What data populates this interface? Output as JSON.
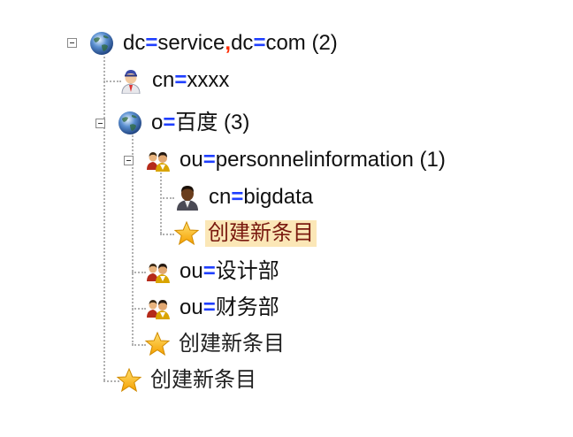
{
  "tree": {
    "root": {
      "attr1": "dc",
      "val1": "service",
      "sep": ",",
      "attr2": "dc",
      "val2": "com",
      "count": "(2)",
      "icon": "globe-icon",
      "children": {
        "user": {
          "attr": "cn",
          "value": "xxxx",
          "icon": "user-icon"
        },
        "org": {
          "attr": "o",
          "value": "百度",
          "count": "(3)",
          "icon": "globe-icon",
          "children": {
            "ou1": {
              "attr": "ou",
              "value": "personnelinformation",
              "count": "(1)",
              "icon": "group-icon",
              "children": {
                "person": {
                  "attr": "cn",
                  "value": "bigdata",
                  "icon": "person-icon"
                },
                "create": {
                  "label": "创建新条目",
                  "icon": "star-icon",
                  "selected": true
                }
              }
            },
            "ou2": {
              "attr": "ou",
              "value": "设计部",
              "icon": "group-icon"
            },
            "ou3": {
              "attr": "ou",
              "value": "财务部",
              "icon": "group-icon"
            },
            "create": {
              "label": "创建新条目",
              "icon": "star-icon"
            }
          }
        },
        "create": {
          "label": "创建新条目",
          "icon": "star-icon"
        }
      }
    },
    "equals": "="
  },
  "colors": {
    "equals": "#1f3fff",
    "comma": "#ff2a00",
    "selected_bg": "#fbe7b7",
    "selected_text": "#7a1a0f",
    "guide": "#b0b0b0"
  }
}
